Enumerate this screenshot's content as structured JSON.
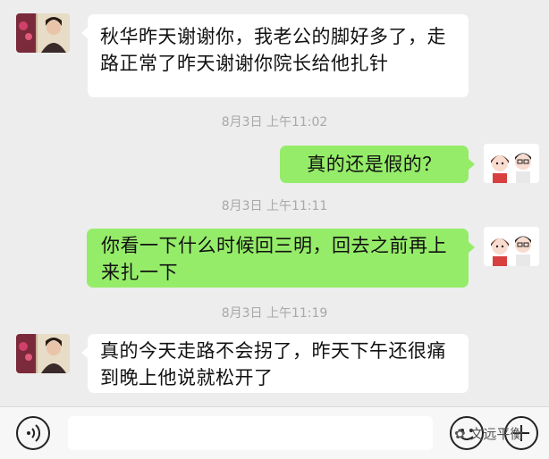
{
  "messages": [
    {
      "side": "left",
      "text": "秋华昨天谢谢你，我老公的脚好多了，走路正常了昨天谢谢你院长给他扎针"
    },
    {
      "time": "8月3日 上午11:02"
    },
    {
      "side": "right",
      "text": "真的还是假的？"
    },
    {
      "time": "8月3日 上午11:11"
    },
    {
      "side": "right",
      "text": "你看一下什么时候回三明，回去之前再上来扎一下"
    },
    {
      "time": "8月3日 上午11:19"
    },
    {
      "side": "left",
      "text": "真的今天走路不会拐了，昨天下午还很痛到晚上他说就松开了"
    }
  ],
  "watermark": "文远平衡",
  "colors": {
    "sent_bubble": "#95ec69",
    "received_bubble": "#ffffff",
    "background": "#ededed"
  },
  "icons": {
    "voice": "voice-icon",
    "emoji": "emoji-icon",
    "plus": "plus-icon"
  }
}
